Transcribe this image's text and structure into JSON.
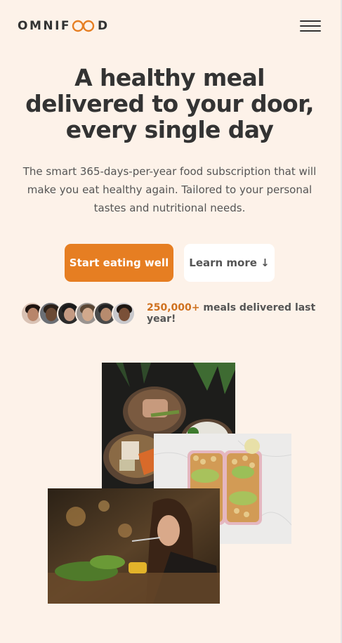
{
  "header": {
    "logo_text_left": "OMNIF",
    "logo_text_right": "D",
    "menu_icon": "menu-icon"
  },
  "hero": {
    "title": "A healthy meal delivered to your door, every single day",
    "description": "The smart 365-days-per-year food subscription that will make you eat healthy again. Tailored to your personal tastes and nutritional needs.",
    "primary_button": "Start eating well",
    "secondary_button": "Learn more ↓"
  },
  "delivered": {
    "count": "250,000+",
    "text": " meals delivered last year!"
  },
  "colors": {
    "background": "#fdf2e9",
    "accent": "#e67e22",
    "accent_dark": "#cf711f",
    "text": "#333333"
  }
}
